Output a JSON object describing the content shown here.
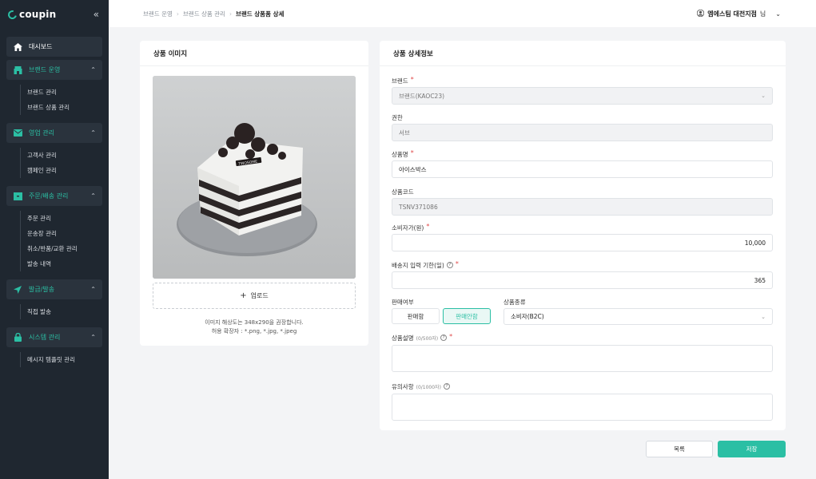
{
  "brand": {
    "logo_text": "coupin",
    "collapse_icon": "double-chevron-left-icon"
  },
  "sidebar": {
    "dashboard": "대시보드",
    "groups": [
      {
        "label": "브랜드 운영",
        "items": [
          "브랜드 관리",
          "브랜드 상품 관리"
        ]
      },
      {
        "label": "영업 관리",
        "items": [
          "고객사 관리",
          "캠페인 관리"
        ]
      },
      {
        "label": "주문/배송 관리",
        "items": [
          "주문 관리",
          "운송장 관리",
          "취소/반품/교환 관리",
          "발송 내역"
        ]
      },
      {
        "label": "발급/발송",
        "items": [
          "직접 발송"
        ]
      },
      {
        "label": "시스템 관리",
        "items": [
          "메시지 템플릿 관리"
        ]
      }
    ],
    "accent_color": "#2bbfa4"
  },
  "header": {
    "breadcrumb": [
      "브랜드 운영",
      "브랜드 상품 관리",
      "브랜드 상품품 상세"
    ],
    "user_name": "엠에스팀 대전지점",
    "user_suffix": "님"
  },
  "image_card": {
    "title": "상품 이미지",
    "upload_label": "업로드",
    "hint_line1": "이미지 해상도는 348x290을 권장합니다.",
    "hint_line2": "허용 확장자 : *.png, *.jpg, *.jpeg",
    "photo_label": "TWOSOME"
  },
  "info_card": {
    "title": "상품 상세정보",
    "brand": {
      "label": "브랜드",
      "value": "브랜드(KAOC23)"
    },
    "permission": {
      "label": "권한",
      "value": "서브"
    },
    "product_name": {
      "label": "상품명",
      "value": "아이스박스"
    },
    "product_code": {
      "label": "상품코드",
      "value": "TSNV371086"
    },
    "price": {
      "label": "소비자가(원)",
      "value": "10,000"
    },
    "deadline": {
      "label": "배송지 입력 기한(일)",
      "value": "365"
    },
    "sale": {
      "label": "판매여부",
      "on": "판매함",
      "off": "판매안함",
      "selected": "판매안함"
    },
    "type": {
      "label": "상품종류",
      "value": "소비자(B2C)"
    },
    "description": {
      "label": "상품설명",
      "counter": "(0/500자)"
    },
    "notes": {
      "label": "유의사항",
      "counter": "(0/1000자)"
    }
  },
  "actions": {
    "list": "목록",
    "save": "저장"
  }
}
